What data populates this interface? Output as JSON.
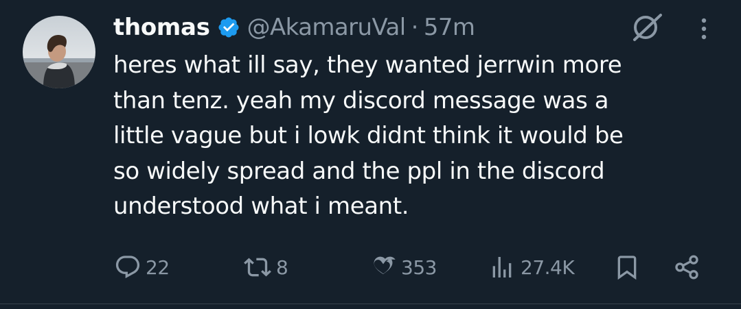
{
  "tweet": {
    "author": {
      "display_name": "thomas",
      "handle": "@AkamaruVal",
      "verified": true
    },
    "separator": "·",
    "time": "57m",
    "text_lines": [
      "heres what ill say, they wanted jerrwin more",
      "than tenz. yeah my discord message was a",
      "little vague but i lowk didnt think it would be",
      "so widely spread and the ppl in the discord",
      "understood what i meant."
    ],
    "actions": {
      "replies": "22",
      "retweets": "8",
      "likes": "353",
      "views": "27.4K"
    }
  },
  "colors": {
    "background": "#15202b",
    "text": "#f7f9f9",
    "secondary": "#8b98a5",
    "verified": "#1d9bf0"
  },
  "icons": [
    "verified-badge-icon",
    "grok-icon",
    "more-icon",
    "reply-icon",
    "retweet-icon",
    "like-icon",
    "views-icon",
    "bookmark-icon",
    "share-icon"
  ]
}
